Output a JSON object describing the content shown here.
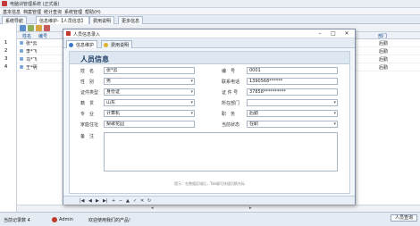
{
  "app": {
    "title": "电脑训管理系统 (正式版)"
  },
  "menu": [
    "基本信息",
    "档案管理",
    "统计查询",
    "系统管理",
    "帮助(H)"
  ],
  "tabs": [
    "系统导航",
    "信息维护-【人员信息】",
    "费用说明",
    "更多信息"
  ],
  "grid": {
    "headers": [
      "姓名",
      "编号",
      "部门"
    ],
    "rows": [
      {
        "num": "1",
        "name": "张*云",
        "dept": "后勤"
      },
      {
        "num": "2",
        "name": "李*飞",
        "dept": "后勤"
      },
      {
        "num": "3",
        "name": "马*飞",
        "dept": "后勤"
      },
      {
        "num": "4",
        "name": "王*明",
        "dept": "后勤"
      }
    ]
  },
  "dialog": {
    "title": "人员信息录入",
    "tabs": [
      "信息维护",
      "费用说明"
    ],
    "form_title": "人员信息",
    "fields": {
      "name_label": "姓　名",
      "name": "张*云",
      "number_label": "编　号",
      "number": "0001",
      "gender_label": "性　别",
      "gender": "男",
      "phone_label": "联系电话",
      "phone": "1390568******",
      "id_type_label": "证件类型",
      "id_type": "身份证",
      "id_no_label": "证 件 号",
      "id_no": "37858**********",
      "origin_label": "籍　贯",
      "origin": "山东",
      "dept_label": "所在部门",
      "dept": "",
      "major_label": "专　业",
      "major": "计算机",
      "duty_label": "职　务",
      "duty": "后勤",
      "address_label": "家庭住址",
      "address": "梨歌花园",
      "status_label": "当前状态",
      "status": "在职",
      "note_label": "备　注"
    },
    "hint": "提示：在数据区域后，Tab键可快速切换光标",
    "nav": [
      "|◀",
      "◀",
      "▶",
      "▶|",
      "+",
      "−",
      "▲",
      "✓",
      "✕",
      "↻"
    ]
  },
  "status": {
    "left": "当前记录数 4",
    "user": "Admin",
    "welcome": "欢迎使用我们的产品!",
    "button": "人员查询"
  },
  "colors": {
    "accent": "#1f3f66",
    "icon_red": "#c63b3b"
  }
}
